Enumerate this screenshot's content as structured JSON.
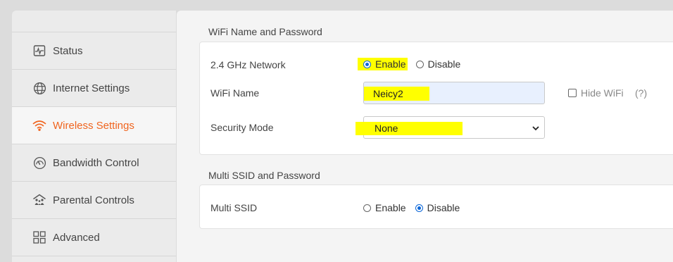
{
  "sidebar": {
    "items": [
      {
        "label": "Status",
        "icon": "monitor-pulse-icon",
        "active": false
      },
      {
        "label": "Internet Settings",
        "icon": "globe-icon",
        "active": false
      },
      {
        "label": "Wireless Settings",
        "icon": "wifi-icon",
        "active": true
      },
      {
        "label": "Bandwidth Control",
        "icon": "gauge-icon",
        "active": false
      },
      {
        "label": "Parental Controls",
        "icon": "family-home-icon",
        "active": false
      },
      {
        "label": "Advanced",
        "icon": "grid-icon",
        "active": false
      }
    ],
    "active_color": "#f0641e"
  },
  "wifi_section": {
    "title": "WiFi Name and Password",
    "network": {
      "label": "2.4 GHz Network",
      "options": [
        "Enable",
        "Disable"
      ],
      "selected": "Enable"
    },
    "wifi_name": {
      "label": "WiFi Name",
      "value": "Neicy2",
      "hide_label": "Hide WiFi",
      "hide_checked": false,
      "help": "(?)"
    },
    "security": {
      "label": "Security Mode",
      "value": "None"
    }
  },
  "multi_section": {
    "title": "Multi SSID and Password",
    "multi_ssid": {
      "label": "Multi SSID",
      "options": [
        "Enable",
        "Disable"
      ],
      "selected": "Disable"
    }
  },
  "colors": {
    "highlight": "#ffff00",
    "radio_checked": "#0a66d8"
  }
}
